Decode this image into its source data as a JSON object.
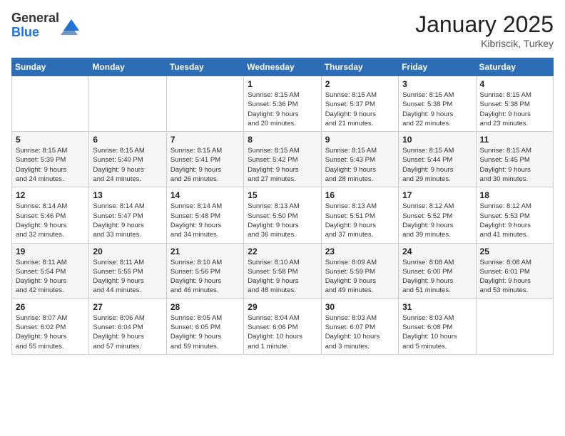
{
  "logo": {
    "general": "General",
    "blue": "Blue"
  },
  "header": {
    "month": "January 2025",
    "location": "Kibriscik, Turkey"
  },
  "weekdays": [
    "Sunday",
    "Monday",
    "Tuesday",
    "Wednesday",
    "Thursday",
    "Friday",
    "Saturday"
  ],
  "weeks": [
    [
      {
        "day": "",
        "info": ""
      },
      {
        "day": "",
        "info": ""
      },
      {
        "day": "",
        "info": ""
      },
      {
        "day": "1",
        "info": "Sunrise: 8:15 AM\nSunset: 5:36 PM\nDaylight: 9 hours\nand 20 minutes."
      },
      {
        "day": "2",
        "info": "Sunrise: 8:15 AM\nSunset: 5:37 PM\nDaylight: 9 hours\nand 21 minutes."
      },
      {
        "day": "3",
        "info": "Sunrise: 8:15 AM\nSunset: 5:38 PM\nDaylight: 9 hours\nand 22 minutes."
      },
      {
        "day": "4",
        "info": "Sunrise: 8:15 AM\nSunset: 5:38 PM\nDaylight: 9 hours\nand 23 minutes."
      }
    ],
    [
      {
        "day": "5",
        "info": "Sunrise: 8:15 AM\nSunset: 5:39 PM\nDaylight: 9 hours\nand 24 minutes."
      },
      {
        "day": "6",
        "info": "Sunrise: 8:15 AM\nSunset: 5:40 PM\nDaylight: 9 hours\nand 24 minutes."
      },
      {
        "day": "7",
        "info": "Sunrise: 8:15 AM\nSunset: 5:41 PM\nDaylight: 9 hours\nand 26 minutes."
      },
      {
        "day": "8",
        "info": "Sunrise: 8:15 AM\nSunset: 5:42 PM\nDaylight: 9 hours\nand 27 minutes."
      },
      {
        "day": "9",
        "info": "Sunrise: 8:15 AM\nSunset: 5:43 PM\nDaylight: 9 hours\nand 28 minutes."
      },
      {
        "day": "10",
        "info": "Sunrise: 8:15 AM\nSunset: 5:44 PM\nDaylight: 9 hours\nand 29 minutes."
      },
      {
        "day": "11",
        "info": "Sunrise: 8:15 AM\nSunset: 5:45 PM\nDaylight: 9 hours\nand 30 minutes."
      }
    ],
    [
      {
        "day": "12",
        "info": "Sunrise: 8:14 AM\nSunset: 5:46 PM\nDaylight: 9 hours\nand 32 minutes."
      },
      {
        "day": "13",
        "info": "Sunrise: 8:14 AM\nSunset: 5:47 PM\nDaylight: 9 hours\nand 33 minutes."
      },
      {
        "day": "14",
        "info": "Sunrise: 8:14 AM\nSunset: 5:48 PM\nDaylight: 9 hours\nand 34 minutes."
      },
      {
        "day": "15",
        "info": "Sunrise: 8:13 AM\nSunset: 5:50 PM\nDaylight: 9 hours\nand 36 minutes."
      },
      {
        "day": "16",
        "info": "Sunrise: 8:13 AM\nSunset: 5:51 PM\nDaylight: 9 hours\nand 37 minutes."
      },
      {
        "day": "17",
        "info": "Sunrise: 8:12 AM\nSunset: 5:52 PM\nDaylight: 9 hours\nand 39 minutes."
      },
      {
        "day": "18",
        "info": "Sunrise: 8:12 AM\nSunset: 5:53 PM\nDaylight: 9 hours\nand 41 minutes."
      }
    ],
    [
      {
        "day": "19",
        "info": "Sunrise: 8:11 AM\nSunset: 5:54 PM\nDaylight: 9 hours\nand 42 minutes."
      },
      {
        "day": "20",
        "info": "Sunrise: 8:11 AM\nSunset: 5:55 PM\nDaylight: 9 hours\nand 44 minutes."
      },
      {
        "day": "21",
        "info": "Sunrise: 8:10 AM\nSunset: 5:56 PM\nDaylight: 9 hours\nand 46 minutes."
      },
      {
        "day": "22",
        "info": "Sunrise: 8:10 AM\nSunset: 5:58 PM\nDaylight: 9 hours\nand 48 minutes."
      },
      {
        "day": "23",
        "info": "Sunrise: 8:09 AM\nSunset: 5:59 PM\nDaylight: 9 hours\nand 49 minutes."
      },
      {
        "day": "24",
        "info": "Sunrise: 8:08 AM\nSunset: 6:00 PM\nDaylight: 9 hours\nand 51 minutes."
      },
      {
        "day": "25",
        "info": "Sunrise: 8:08 AM\nSunset: 6:01 PM\nDaylight: 9 hours\nand 53 minutes."
      }
    ],
    [
      {
        "day": "26",
        "info": "Sunrise: 8:07 AM\nSunset: 6:02 PM\nDaylight: 9 hours\nand 55 minutes."
      },
      {
        "day": "27",
        "info": "Sunrise: 8:06 AM\nSunset: 6:04 PM\nDaylight: 9 hours\nand 57 minutes."
      },
      {
        "day": "28",
        "info": "Sunrise: 8:05 AM\nSunset: 6:05 PM\nDaylight: 9 hours\nand 59 minutes."
      },
      {
        "day": "29",
        "info": "Sunrise: 8:04 AM\nSunset: 6:06 PM\nDaylight: 10 hours\nand 1 minute."
      },
      {
        "day": "30",
        "info": "Sunrise: 8:03 AM\nSunset: 6:07 PM\nDaylight: 10 hours\nand 3 minutes."
      },
      {
        "day": "31",
        "info": "Sunrise: 8:03 AM\nSunset: 6:08 PM\nDaylight: 10 hours\nand 5 minutes."
      },
      {
        "day": "",
        "info": ""
      }
    ]
  ]
}
